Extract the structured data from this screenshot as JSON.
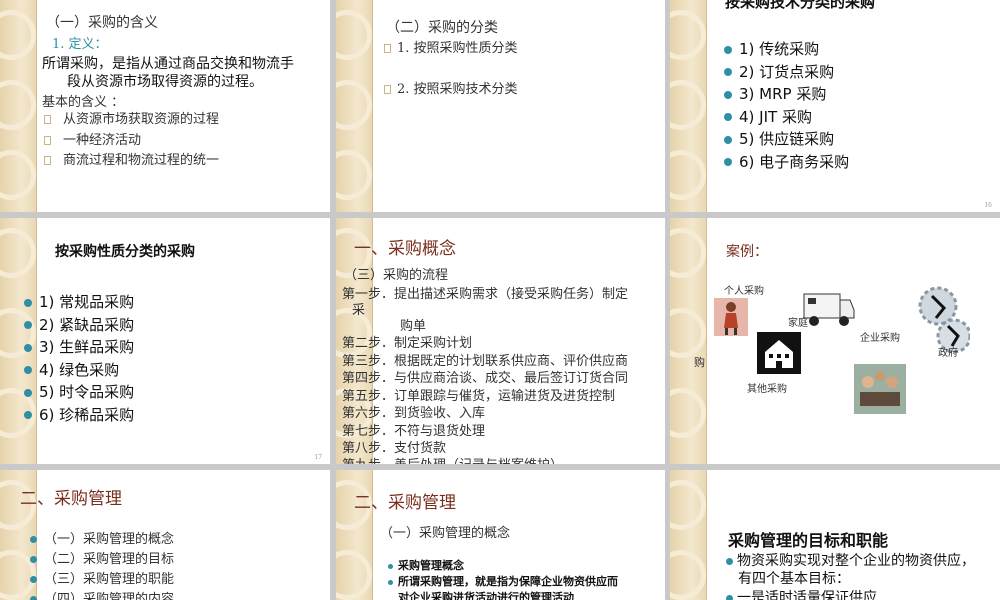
{
  "s1": {
    "subtitle": "（一）采购的含义",
    "def_label": "1. 定义：",
    "def_line1": "所谓采购，是指从通过商品交换和物流手",
    "def_line2": "段从资源市场取得资源的过程。",
    "basic": "基本的含义 ：",
    "items": [
      "从资源市场获取资源的过程",
      "一种经济活动",
      "商流过程和物流过程的统一"
    ]
  },
  "s2": {
    "subtitle": "（二）采购的分类",
    "items": [
      "1. 按照采购性质分类",
      "2. 按照采购技术分类"
    ]
  },
  "s3": {
    "title": "按采购技术分类的采购",
    "items": [
      "1) 传统采购",
      "2) 订货点采购",
      "3) MRP 采购",
      "4) JIT 采购",
      "5) 供应链采购",
      "6) 电子商务采购"
    ],
    "page": "16"
  },
  "s4": {
    "title": "按采购性质分类的采购",
    "items": [
      "1) 常规品采购",
      "2) 紧缺品采购",
      "3) 生鲜品采购",
      "4) 绿色采购",
      "5) 时令品采购",
      "6) 珍稀品采购"
    ],
    "page": "17"
  },
  "s5": {
    "title": "一、采购概念",
    "subtitle": "（三）采购的流程",
    "steps": [
      "第一步．提出描述采购需求（接受采购任务）制定",
      "采",
      "购单",
      "第二步．制定采购计划",
      "第三步．根据既定的计划联系供应商、评价供应商",
      "第四步．与供应商洽谈、成交、最后签订订货合同",
      "第五步．订单跟踪与催货，运输进货及进货控制",
      "第六步．到货验收、入库",
      "第七步．不符与退货处理",
      "第八步．支付货款",
      "第九步．善后处理（记录与档案维护）"
    ]
  },
  "s6": {
    "case": "案例：",
    "personal": "个人采购",
    "home": "家庭",
    "enterprise": "企业采购",
    "other": "其他采购",
    "gov": "政府",
    "buy_char": "购"
  },
  "s7": {
    "title": "二、采购管理",
    "items": [
      "（一）采购管理的概念",
      "（二）采购管理的目标",
      "（三）采购管理的职能",
      "（四）采购管理的内容"
    ]
  },
  "s8": {
    "title": "二、采购管理",
    "subtitle": "（一）采购管理的概念",
    "items": [
      "采购管理概念",
      "所谓采购管理，就是指为保障企业物资供应而",
      "对企业采购进货活动进行的管理活动"
    ]
  },
  "s9": {
    "title": "采购管理的目标和职能",
    "line1": "物资采购实现对整个企业的物资供应，",
    "line2": "有四个基本目标：",
    "line3": "一是适时适量保证供应"
  },
  "colors": {
    "accent": "#2f8fa6",
    "title_red": "#7a2f1c",
    "deco": "#e6d3ab"
  }
}
